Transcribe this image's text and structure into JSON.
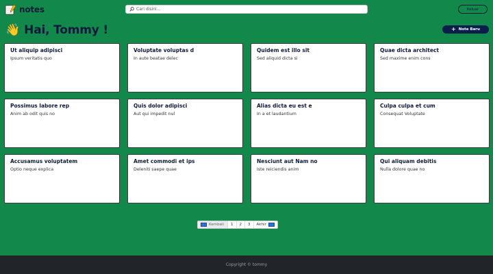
{
  "navbar": {
    "brand": "notes",
    "search_placeholder": "Cari disini...",
    "logout_label": "Keluar"
  },
  "greeting": {
    "emoji": "👋",
    "text": "Hai, Tommy !"
  },
  "new_note_label": "Note Baru",
  "notes": [
    {
      "title": "Ut aliquip adipisci",
      "body": "Ipsum veritatis quo"
    },
    {
      "title": "Voluptate voluptas d",
      "body": "In aute beatae delec"
    },
    {
      "title": "Quidem est illo sit",
      "body": "Sed aliquid dicta si"
    },
    {
      "title": "Quae dicta architect",
      "body": "Sed maxime enim cons"
    },
    {
      "title": "Possimus labore rep",
      "body": "Anim ab odit quis no"
    },
    {
      "title": "Quis dolor adipisci",
      "body": "Aut qui impedit nul"
    },
    {
      "title": "Alias dicta eu est e",
      "body": "In a et laudantium"
    },
    {
      "title": "Culpa culpa et cum",
      "body": "Consequat Voluptate"
    },
    {
      "title": "Accusamus voluptatem",
      "body": "Optio neque explica"
    },
    {
      "title": "Amet commodi et ips",
      "body": "Deleniti saepe quae"
    },
    {
      "title": "Nesciunt aut Nam no",
      "body": "Iste reiciendis anim"
    },
    {
      "title": "Qui aliquam debitis",
      "body": "Nulla dolore quae no"
    }
  ],
  "pagination": {
    "prev_label": "Kembali",
    "pages": [
      "1",
      "2",
      "3"
    ],
    "last_label": "Akhir"
  },
  "footer": {
    "copyright": "Copyright © tommy"
  },
  "colors": {
    "background": "#12894a",
    "navy": "#0e1b3a",
    "footer": "#212529"
  }
}
